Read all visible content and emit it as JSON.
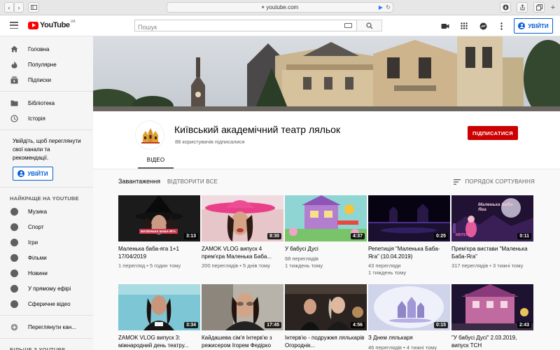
{
  "browser": {
    "url": "youtube.com",
    "icons": {
      "back": "chevron-left-icon",
      "forward": "chevron-right-icon",
      "sidebar": "sidebar-icon",
      "lock": "lock-icon",
      "reload": "reload-icon",
      "download": "download-icon",
      "share": "share-icon",
      "tabs": "tabs-icon",
      "new_tab": "plus-icon"
    }
  },
  "header": {
    "logo_text": "YouTube",
    "logo_region": "UA",
    "search_placeholder": "Пошук",
    "signin_label": "УВІЙТИ",
    "accent": "#065fd4",
    "brand_red": "#ff0000"
  },
  "sidebar": {
    "primary": [
      {
        "label": "Головна",
        "icon": "home-icon"
      },
      {
        "label": "Популярне",
        "icon": "flame-icon"
      },
      {
        "label": "Підписки",
        "icon": "subscriptions-icon"
      }
    ],
    "library": [
      {
        "label": "Бібліотека",
        "icon": "folder-icon"
      },
      {
        "label": "Історія",
        "icon": "history-icon"
      }
    ],
    "signin_text": "Увійдіть, щоб переглянути свої канали та рекомендації.",
    "signin_label": "УВІЙТИ",
    "best_header": "НАЙКРАЩЕ НА YOUTUBE",
    "best": [
      {
        "label": "Музика",
        "icon": "music-icon"
      },
      {
        "label": "Спорт",
        "icon": "sports-icon"
      },
      {
        "label": "Ігри",
        "icon": "gaming-icon"
      },
      {
        "label": "Фільми",
        "icon": "movies-icon"
      },
      {
        "label": "Новини",
        "icon": "news-icon"
      },
      {
        "label": "У прямому ефірі",
        "icon": "live-icon"
      },
      {
        "label": "Сферичне відео",
        "icon": "spherical-video-icon"
      }
    ],
    "browse_channels": {
      "label": "Переглянути кан...",
      "icon": "add-circle-icon"
    },
    "more_header": "БІЛЬШЕ З YOUTUBE"
  },
  "channel": {
    "name": "Київський академічний театр ляльок",
    "subscribers": "88 користувачів підписалися",
    "subscribe_label": "ПІДПИСАТИСЯ",
    "subscribe_color": "#cc0000",
    "tab": "ВІДЕО"
  },
  "section": {
    "title": "Завантаження",
    "play_all": "ВІДТВОРИТИ ВСЕ",
    "sort_by": "ПОРЯДОК СОРТУВАННЯ"
  },
  "videos": [
    {
      "title": "Маленька баба-яга 1+1 17/04/2019",
      "views": "1 перегляд",
      "age": "5 годин тому",
      "duration": "3:13"
    },
    {
      "title": "ZAMOK VLOG випуск 4 прем'єра Маленька Баба...",
      "views": "200 переглядів",
      "age": "5 днів тому",
      "duration": "8:30"
    },
    {
      "title": "У бабусі Дусі",
      "views": "68 переглядів",
      "age": "1 тиждень тому",
      "duration": "4:37"
    },
    {
      "title": "Репетиція \"Маленька Баба-Яга\" (10.04.2019)",
      "views": "43 перегляди",
      "age": "1 тиждень тому",
      "duration": "0:25"
    },
    {
      "title": "Прем'єра вистави \"Маленька Баба-Яга\"",
      "views": "317 переглядів",
      "age": "3 тижні тому",
      "duration": "0:11"
    },
    {
      "title": "ZAMOK VLOG випуск 3: міжнародний день театру...",
      "views": "",
      "age": "",
      "duration": "3:34"
    },
    {
      "title": "Кайдашева сім'я Інтерв'ю з режисером Ігорем Федірко",
      "views": "",
      "age": "",
      "duration": "17:45"
    },
    {
      "title": "Інтерв'ю - подружжя лялькарів Огороднік...",
      "views": "",
      "age": "",
      "duration": "4:56"
    },
    {
      "title": "З Днем лялькаря",
      "views": "46 переглядів",
      "age": "4 тижні тому",
      "duration": "0:15"
    },
    {
      "title": "\"У бабусі Дусі\" 2.03.2019, випуск ТСН",
      "views": "",
      "age": "",
      "duration": "2:43"
    }
  ],
  "thumb_texts": {
    "v1_caption": "МАЛЕНЬКА БАБА-ЯГА",
    "v5_title": "Маленька Баба-Яга",
    "v5_sub": "КВІТЕНЬ"
  }
}
